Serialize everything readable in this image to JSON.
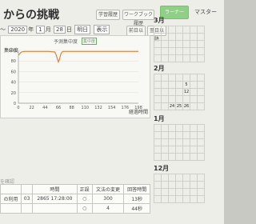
{
  "header": {
    "title": "からの挑戦",
    "buttons": [
      "学習履歴",
      "ワークブック履歴"
    ],
    "tabs": [
      {
        "label": "ラーナー",
        "active": true
      },
      {
        "label": "マスター",
        "active": false
      }
    ]
  },
  "datebar": {
    "arrow": "〜",
    "year": "2020",
    "year_unit": "年",
    "month": "1",
    "month_unit": "月",
    "day": "28",
    "day_unit": "日",
    "button1": "明日",
    "button2": "表示"
  },
  "right_buttons": [
    "前日以前",
    "翌日以降"
  ],
  "chart": {
    "panel_title": "予測集中度",
    "legend": "集中度"
  },
  "chart_data": {
    "type": "line",
    "ylabel": "集中度",
    "xlabel": "経過時間",
    "yticks": [
      "100",
      "80",
      "60",
      "40",
      "20",
      "0"
    ],
    "ylim": [
      0,
      100
    ],
    "xticks": [
      "0",
      "22",
      "44",
      "66",
      "88",
      "110",
      "132",
      "154",
      "176",
      "198"
    ],
    "xlim": [
      0,
      198
    ],
    "color": "#d9833a",
    "series": [
      {
        "x": [
          0,
          5,
          10,
          15,
          20,
          25,
          30,
          40,
          50,
          60,
          62,
          64,
          66,
          68,
          70,
          72,
          74,
          80,
          90,
          100,
          110,
          120,
          130,
          140,
          150,
          160,
          170,
          180,
          190,
          198
        ],
        "y": [
          91,
          97,
          98,
          98,
          98,
          98,
          98,
          98,
          98,
          97,
          92,
          85,
          78,
          84,
          93,
          97,
          98,
          98,
          98,
          98,
          98,
          98,
          98,
          98,
          98,
          98,
          98,
          98,
          98,
          98
        ]
      }
    ]
  },
  "calendars": [
    {
      "month": "3月",
      "rows": [
        [
          "",
          "",
          "",
          "",
          "",
          "",
          ""
        ],
        [
          "",
          "",
          "",
          "",
          "",
          "",
          ""
        ],
        [
          "",
          "",
          "",
          "",
          "",
          "",
          ""
        ],
        [
          "",
          "",
          "",
          "",
          "",
          "",
          ""
        ],
        [
          "",
          "",
          "",
          "",
          "",
          "",
          ""
        ]
      ]
    },
    {
      "month": "2月",
      "rows": [
        [
          "",
          "",
          "",
          "",
          "",
          "",
          ""
        ],
        [
          "",
          "",
          "",
          "",
          "5",
          "",
          ""
        ],
        [
          "",
          "",
          "",
          "",
          "12",
          "",
          ""
        ],
        [
          "",
          "",
          "",
          "",
          "",
          "",
          ""
        ],
        [
          "",
          "",
          "24",
          "25",
          "26",
          "",
          ""
        ]
      ]
    },
    {
      "month": "1月",
      "rows": [
        [
          "",
          "",
          "",
          "",
          "",
          "",
          ""
        ],
        [
          "",
          "",
          "",
          "",
          "",
          "",
          ""
        ],
        [
          "",
          "",
          "",
          "",
          "",
          "",
          ""
        ],
        [
          "",
          "",
          "",
          "",
          "",
          "",
          ""
        ],
        [
          "",
          "",
          "",
          "",
          "",
          "",
          ""
        ]
      ]
    },
    {
      "month": "12月",
      "rows": [
        [
          "",
          "",
          "",
          "",
          "",
          "",
          ""
        ],
        [
          "",
          "",
          "",
          "",
          "",
          "",
          ""
        ],
        [
          "",
          "",
          "",
          "",
          "",
          "",
          ""
        ],
        [
          "",
          "",
          "",
          "",
          "",
          "",
          ""
        ]
      ]
    }
  ],
  "log": {
    "section": "を確認",
    "headers": [
      "",
      "",
      "時間",
      "正誤",
      "文法の変更",
      "回答時間"
    ],
    "rows": [
      [
        "の利用",
        "03",
        "2865 17:28:00",
        "○",
        "300",
        "13秒"
      ],
      [
        "",
        "",
        "",
        "○",
        "4",
        "44秒"
      ]
    ]
  }
}
